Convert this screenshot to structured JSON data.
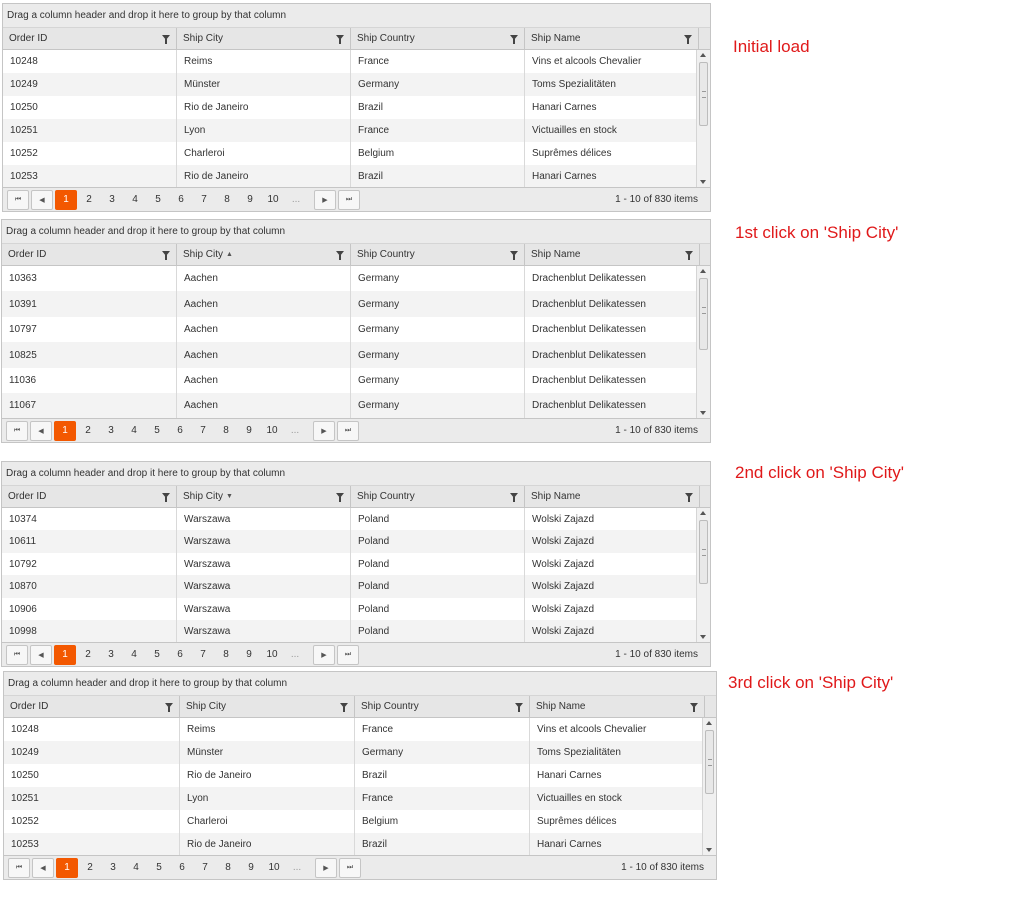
{
  "group_panel_text": "Drag a column header and drop it here to group by that column",
  "columns": [
    "Order ID",
    "Ship City",
    "Ship Country",
    "Ship Name"
  ],
  "pager": {
    "first_icon": "⏮",
    "prev_icon": "◀",
    "next_icon": "▶",
    "last_icon": "⏭",
    "pages": [
      "1",
      "2",
      "3",
      "4",
      "5",
      "6",
      "7",
      "8",
      "9",
      "10",
      "..."
    ],
    "active_page": "1",
    "info": "1 - 10 of 830 items"
  },
  "icons": {
    "filter": "filter-icon",
    "sort_asc": "▲",
    "sort_desc": "▼"
  },
  "colors": {
    "accent": "#f35800",
    "annotation": "#e0191a"
  },
  "grids": [
    {
      "annotation": "Initial load",
      "sort": "",
      "rows": [
        [
          "10248",
          "Reims",
          "France",
          "Vins et alcools Chevalier"
        ],
        [
          "10249",
          "Münster",
          "Germany",
          "Toms Spezialitäten"
        ],
        [
          "10250",
          "Rio de Janeiro",
          "Brazil",
          "Hanari Carnes"
        ],
        [
          "10251",
          "Lyon",
          "France",
          "Victuailles en stock"
        ],
        [
          "10252",
          "Charleroi",
          "Belgium",
          "Suprêmes délices"
        ],
        [
          "10253",
          "Rio de Janeiro",
          "Brazil",
          "Hanari Carnes"
        ]
      ]
    },
    {
      "annotation": "1st click on 'Ship City'",
      "sort": "asc",
      "rows": [
        [
          "10363",
          "Aachen",
          "Germany",
          "Drachenblut Delikatessen"
        ],
        [
          "10391",
          "Aachen",
          "Germany",
          "Drachenblut Delikatessen"
        ],
        [
          "10797",
          "Aachen",
          "Germany",
          "Drachenblut Delikatessen"
        ],
        [
          "10825",
          "Aachen",
          "Germany",
          "Drachenblut Delikatessen"
        ],
        [
          "11036",
          "Aachen",
          "Germany",
          "Drachenblut Delikatessen"
        ],
        [
          "11067",
          "Aachen",
          "Germany",
          "Drachenblut Delikatessen"
        ]
      ]
    },
    {
      "annotation": "2nd click on 'Ship City'",
      "sort": "desc",
      "rows": [
        [
          "10374",
          "Warszawa",
          "Poland",
          "Wolski Zajazd"
        ],
        [
          "10611",
          "Warszawa",
          "Poland",
          "Wolski Zajazd"
        ],
        [
          "10792",
          "Warszawa",
          "Poland",
          "Wolski Zajazd"
        ],
        [
          "10870",
          "Warszawa",
          "Poland",
          "Wolski Zajazd"
        ],
        [
          "10906",
          "Warszawa",
          "Poland",
          "Wolski Zajazd"
        ],
        [
          "10998",
          "Warszawa",
          "Poland",
          "Wolski Zajazd"
        ]
      ]
    },
    {
      "annotation": "3rd click on 'Ship City'",
      "sort": "",
      "rows": [
        [
          "10248",
          "Reims",
          "France",
          "Vins et alcools Chevalier"
        ],
        [
          "10249",
          "Münster",
          "Germany",
          "Toms Spezialitäten"
        ],
        [
          "10250",
          "Rio de Janeiro",
          "Brazil",
          "Hanari Carnes"
        ],
        [
          "10251",
          "Lyon",
          "France",
          "Victuailles en stock"
        ],
        [
          "10252",
          "Charleroi",
          "Belgium",
          "Suprêmes délices"
        ],
        [
          "10253",
          "Rio de Janeiro",
          "Brazil",
          "Hanari Carnes"
        ]
      ]
    }
  ]
}
